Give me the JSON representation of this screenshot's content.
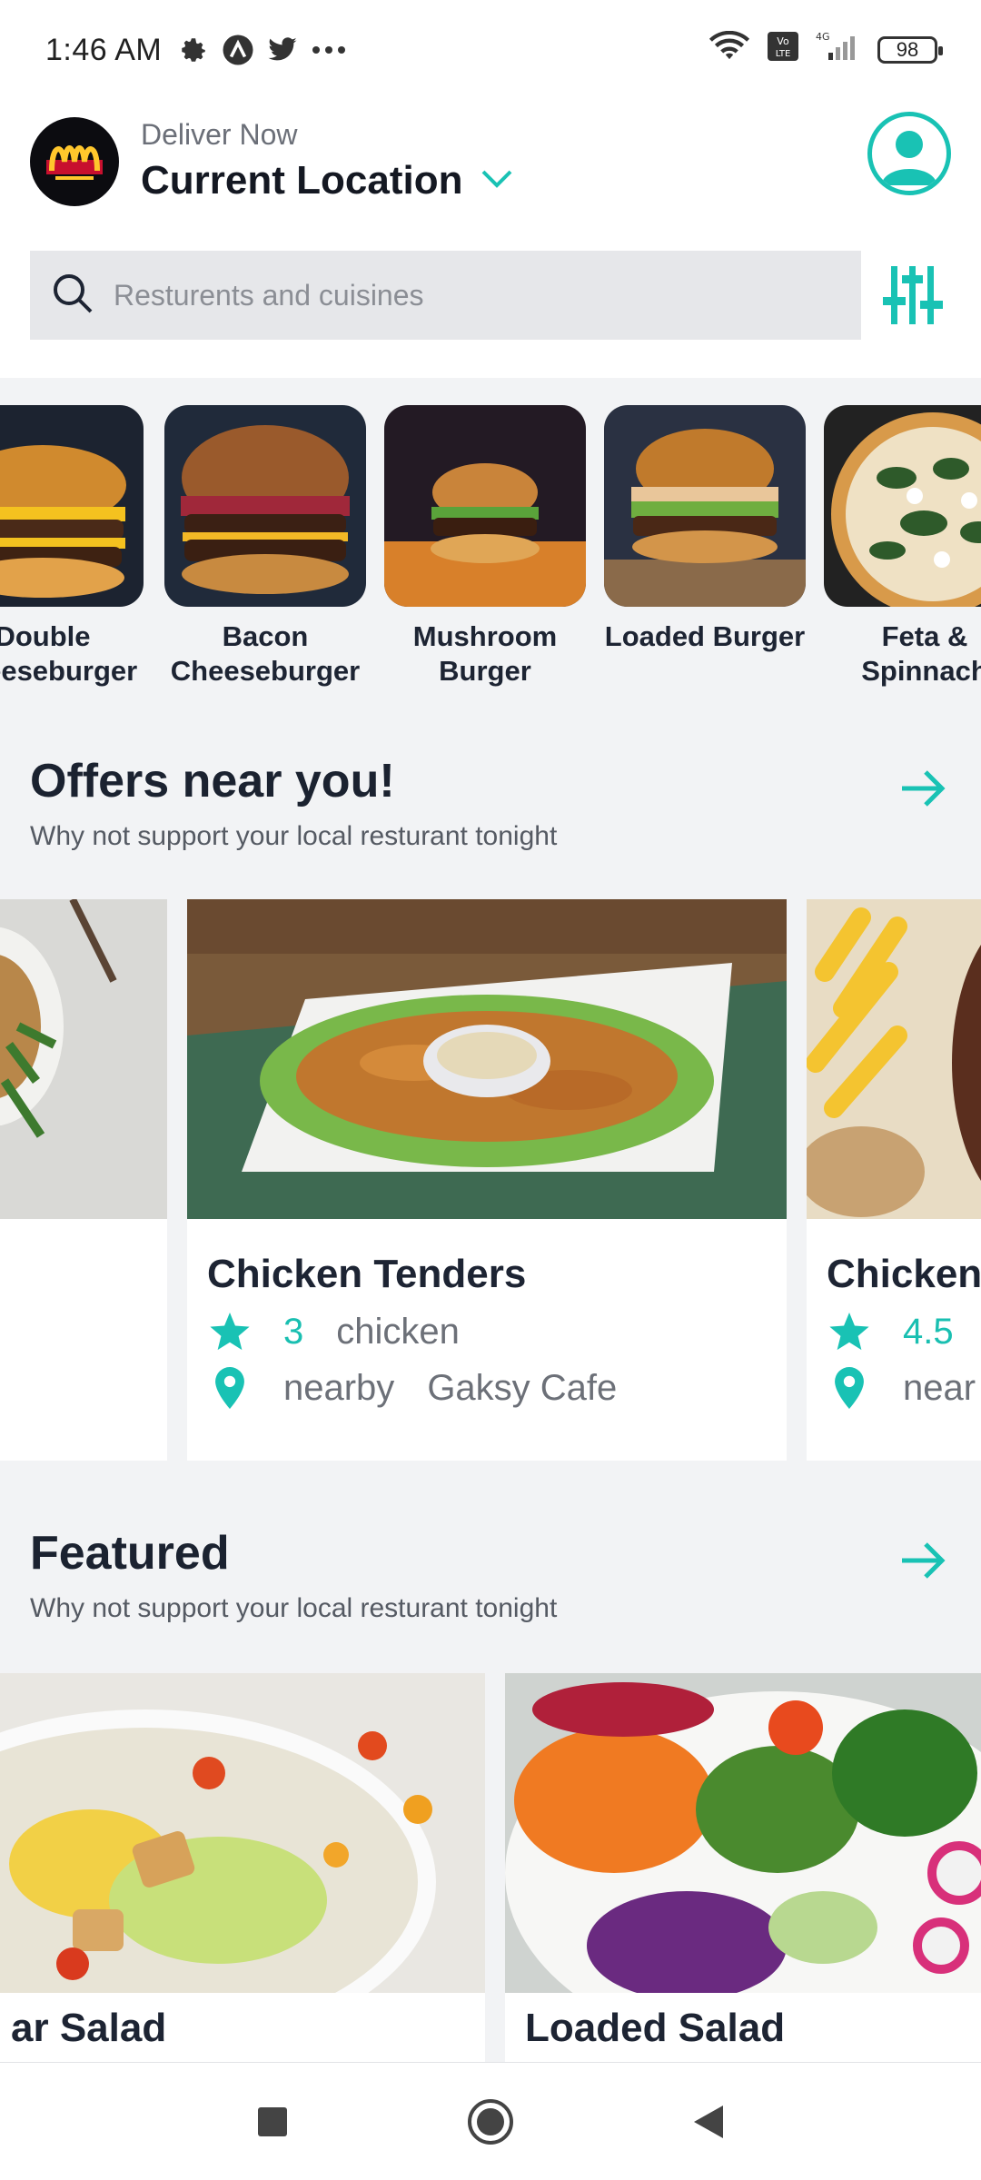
{
  "status_bar": {
    "time": "1:46 AM",
    "battery": "98",
    "network": "4G",
    "volte": "Vo LTE",
    "icons": [
      "gear-icon",
      "app-a-icon",
      "twitter-icon",
      "more-dots-icon",
      "wifi-icon",
      "volte-icon",
      "signal-icon",
      "battery-icon"
    ]
  },
  "header": {
    "deliver_label": "Deliver Now",
    "location": "Current Location",
    "logo": "mcdonalds-logo"
  },
  "search": {
    "placeholder": "Resturents and cuisines"
  },
  "categories": [
    {
      "name": "Double\nCheeseburger"
    },
    {
      "name": "Bacon\nCheeseburger"
    },
    {
      "name": "Mushroom\nBurger"
    },
    {
      "name": "Loaded Burger"
    },
    {
      "name": "Feta &\nSpinnach"
    }
  ],
  "offers": {
    "title": "Offers near you!",
    "subtitle": "Why not support your local resturant tonight",
    "cards": [
      {
        "title": "",
        "rating": "",
        "tag": "",
        "distance": "",
        "restaurant": ""
      },
      {
        "title": "Chicken Tenders",
        "rating": "3",
        "tag": "chicken",
        "distance": "nearby",
        "restaurant": "Gaksy Cafe"
      },
      {
        "title": "Chicken",
        "rating": "4.5",
        "tag": "",
        "distance": "near",
        "restaurant": ""
      }
    ]
  },
  "featured": {
    "title": "Featured",
    "subtitle": "Why not support your local resturant tonight",
    "cards": [
      {
        "title": "ar Salad"
      },
      {
        "title": "Loaded Salad"
      }
    ]
  },
  "colors": {
    "accent": "#19c2b4",
    "text_dark": "#1d2433",
    "text_muted": "#6c7078",
    "background": "#f2f3f5"
  }
}
